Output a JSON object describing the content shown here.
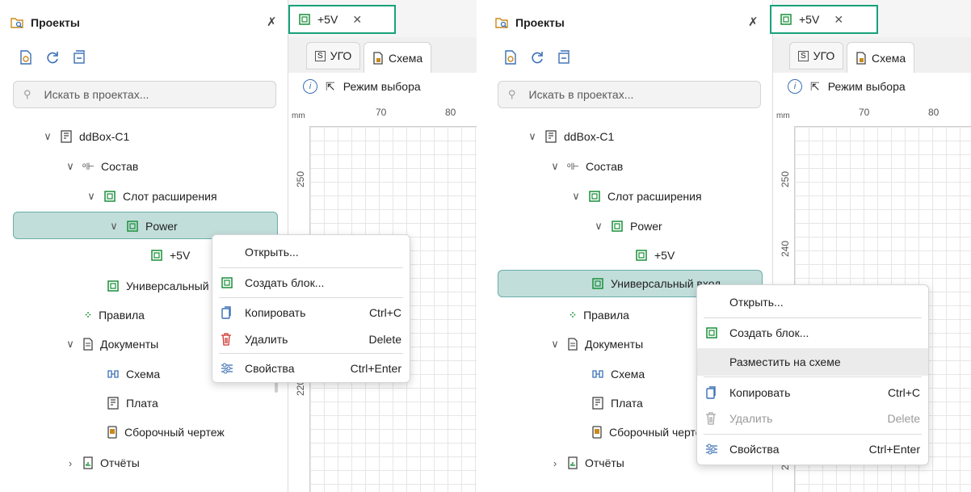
{
  "colors": {
    "accent_green": "#17a27a",
    "selection_bg": "#c2dedb",
    "selection_border": "#6aaea8",
    "icon_green": "#1a8f3a"
  },
  "panel": {
    "title": "Проекты",
    "search_placeholder": "Искать в проектах...",
    "toolbar_icons": [
      "view-icon",
      "refresh-icon",
      "collapse-icon"
    ]
  },
  "tree": {
    "device": "ddBox-C1",
    "composition": "Состав",
    "expansion_slot": "Слот расширения",
    "power": "Power",
    "plus5v": "+5V",
    "universal": "Универсальный",
    "universal_full": "Универсальный вход",
    "rules": "Правила",
    "documents": "Документы",
    "schema": "Схема",
    "board": "Плата",
    "assembly": "Сборочный чертеж",
    "reports": "Отчёты"
  },
  "editor": {
    "doc_tab": "+5V",
    "subtab_ugo": "УГО",
    "subtab_schema": "Схема",
    "mode": "Режим выбора",
    "ruler_unit": "mm",
    "ruler_x": [
      "70",
      "80"
    ],
    "ruler_y_left": [
      "250",
      "220"
    ],
    "ruler_y_right": [
      "250",
      "240",
      "210"
    ]
  },
  "menu_left": {
    "open": "Открыть...",
    "create_block": "Создать блок...",
    "copy": "Копировать",
    "copy_sc": "Ctrl+C",
    "delete": "Удалить",
    "delete_sc": "Delete",
    "props": "Свойства",
    "props_sc": "Ctrl+Enter"
  },
  "menu_right": {
    "open": "Открыть...",
    "create_block": "Создать блок...",
    "place": "Разместить на схеме",
    "copy": "Копировать",
    "copy_sc": "Ctrl+C",
    "delete": "Удалить",
    "delete_sc": "Delete",
    "props": "Свойства",
    "props_sc": "Ctrl+Enter"
  }
}
